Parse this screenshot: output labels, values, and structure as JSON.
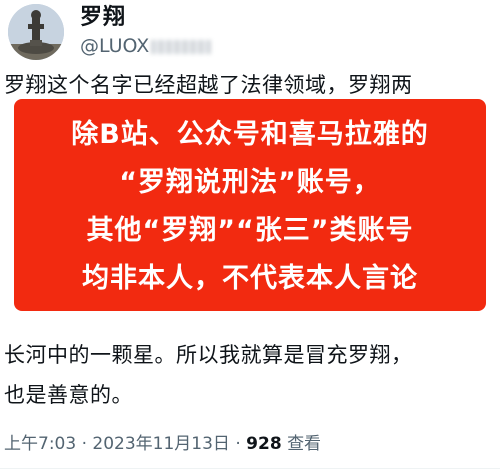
{
  "author": {
    "name": "罗翔",
    "handle": "@LUOX"
  },
  "tweet": {
    "line1": "罗翔这个名字已经超越了法律领域，罗翔两",
    "line_bottom1": "长河中的一颗星。所以我就算是冒充罗翔，",
    "line_bottom2": "也是善意的。"
  },
  "notice": {
    "lines": [
      "除B站、公众号和喜马拉雅的",
      "“罗翔说刑法”账号，",
      "其他“罗翔”“张三”类账号",
      "均非本人，不代表本人言论"
    ],
    "background_color": "#f22a10"
  },
  "meta": {
    "time": "上午7:03",
    "date": "2023年11月13日",
    "views_count": "928",
    "views_label": "查看"
  }
}
